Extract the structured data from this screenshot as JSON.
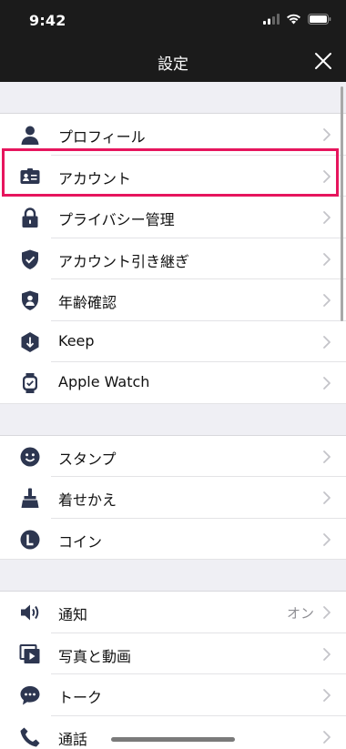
{
  "status_bar": {
    "time": "9:42"
  },
  "nav": {
    "title": "設定"
  },
  "sections": [
    [
      {
        "name": "profile",
        "icon": "person-icon",
        "label": "プロフィール"
      },
      {
        "name": "account",
        "icon": "id-card-icon",
        "label": "アカウント"
      },
      {
        "name": "privacy",
        "icon": "lock-icon",
        "label": "プライバシー管理"
      },
      {
        "name": "account-transfer",
        "icon": "shield-check-icon",
        "label": "アカウント引き継ぎ"
      },
      {
        "name": "age-verification",
        "icon": "shield-person-icon",
        "label": "年齢確認"
      },
      {
        "name": "keep",
        "icon": "keep-icon",
        "label": "Keep"
      },
      {
        "name": "apple-watch",
        "icon": "watch-icon",
        "label": "Apple Watch"
      }
    ],
    [
      {
        "name": "stickers",
        "icon": "smiley-icon",
        "label": "スタンプ"
      },
      {
        "name": "themes",
        "icon": "brush-icon",
        "label": "着せかえ"
      },
      {
        "name": "coins",
        "icon": "coin-icon",
        "label": "コイン"
      }
    ],
    [
      {
        "name": "notifications",
        "icon": "speaker-icon",
        "label": "通知",
        "value": "オン"
      },
      {
        "name": "photos-videos",
        "icon": "media-icon",
        "label": "写真と動画"
      },
      {
        "name": "chats",
        "icon": "chat-bubble-icon",
        "label": "トーク"
      },
      {
        "name": "calls",
        "icon": "phone-icon",
        "label": "通話"
      }
    ]
  ],
  "colors": {
    "icon": "#2d3650",
    "highlight": "#e6155d",
    "header_bg": "#1b1b1b"
  }
}
